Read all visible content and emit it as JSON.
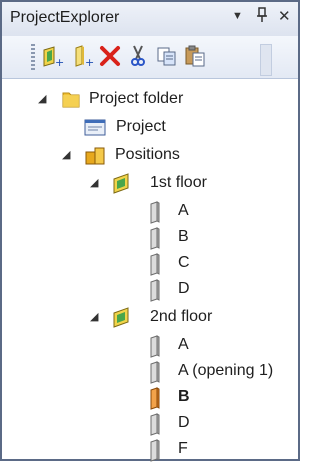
{
  "panel": {
    "title": "ProjectExplorer",
    "controls": {
      "menu_glyph": "▼",
      "pin_glyph": "ᵾ",
      "close_glyph": "✕"
    }
  },
  "toolbar": {
    "buttons": [
      {
        "icon": "new-position-icon"
      },
      {
        "icon": "new-element-icon"
      },
      {
        "icon": "delete-icon"
      },
      {
        "icon": "cut-icon"
      },
      {
        "icon": "copy-icon"
      },
      {
        "icon": "paste-icon"
      }
    ]
  },
  "tree": {
    "project_folder": "Project folder",
    "project": "Project",
    "positions": "Positions",
    "floor1": {
      "label": "1st floor",
      "children": [
        "A",
        "B",
        "C",
        "D"
      ]
    },
    "floor2": {
      "label": "2nd floor",
      "children": [
        "A",
        "A (opening 1)",
        "B",
        "D",
        "F"
      ],
      "selected": "B"
    }
  },
  "colors": {
    "accent_orange": "#e8892a",
    "delete_red": "#d9221a",
    "folder_yellow": "#f2c234"
  }
}
